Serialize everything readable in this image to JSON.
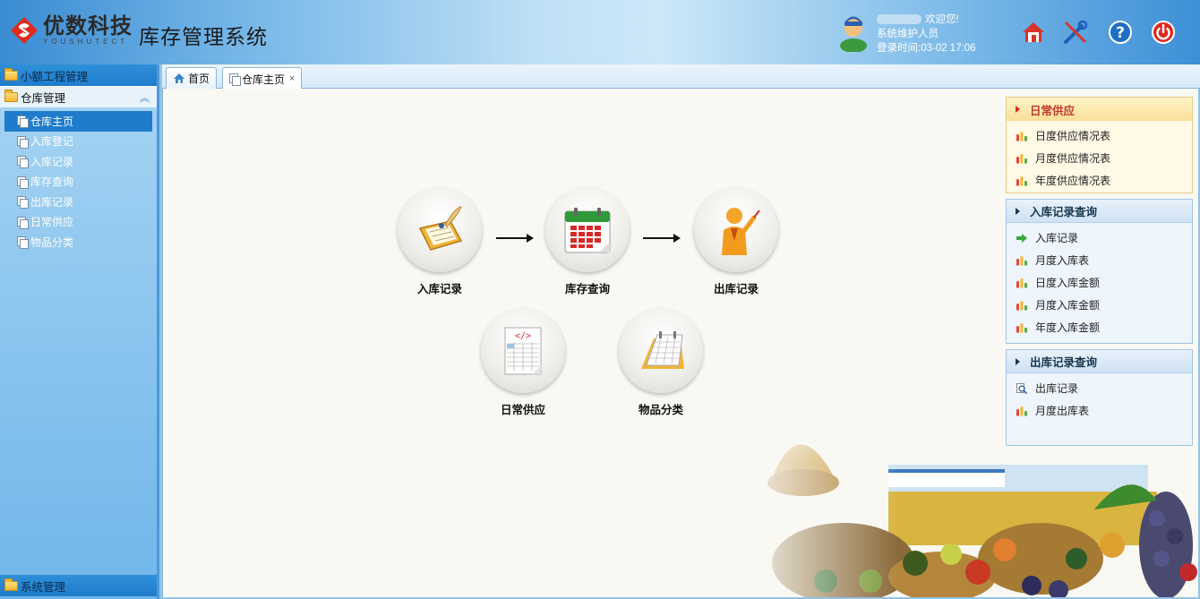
{
  "header": {
    "logo_cn": "优数科技",
    "logo_en": "YOUSHUTECT",
    "app_title": "库存管理系统",
    "welcome": "欢迎您!",
    "role": "系统维护人员",
    "login_time": "登录时间:03-02 17:06",
    "buttons": [
      "home-icon",
      "tools-icon",
      "help-icon",
      "power-icon"
    ]
  },
  "sidebar": {
    "top_group": "小额工程管理",
    "open_group": "仓库管理",
    "items": [
      {
        "label": "仓库主页",
        "active": true
      },
      {
        "label": "入库登记"
      },
      {
        "label": "入库记录"
      },
      {
        "label": "库存查询"
      },
      {
        "label": "出库记录"
      },
      {
        "label": "日常供应"
      },
      {
        "label": "物品分类"
      }
    ],
    "bottom_group": "系统管理"
  },
  "tabs": [
    {
      "label": "首页",
      "icon": "home-icon"
    },
    {
      "label": "仓库主页",
      "icon": "page-icon",
      "closable": true,
      "active": true
    }
  ],
  "flow": {
    "nodes": [
      "入库记录",
      "库存查询",
      "出库记录",
      "日常供应",
      "物品分类"
    ]
  },
  "panels": [
    {
      "title": "日常供应",
      "style": "yellow",
      "items": [
        "日度供应情况表",
        "月度供应情况表",
        "年度供应情况表"
      ]
    },
    {
      "title": "入库记录查询",
      "style": "blue",
      "items": [
        "入库记录",
        "月度入库表",
        "日度入库金额",
        "月度入库金额",
        "年度入库金额"
      ]
    },
    {
      "title": "出库记录查询",
      "style": "blue",
      "items": [
        "出库记录",
        "月度出库表"
      ]
    }
  ],
  "colors": {
    "accent_blue": "#1f7ccc",
    "panel_title_red": "#c0392b"
  }
}
